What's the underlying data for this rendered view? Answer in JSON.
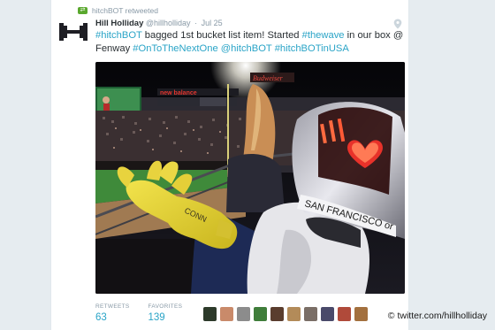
{
  "retweet_line": "hitchBOT retweeted",
  "tweet": {
    "author_name": "Hill Holliday",
    "handle": "@hillholliday",
    "separator": "·",
    "date": "Jul 25",
    "text_segments": [
      {
        "type": "tag",
        "text": "#hitchBOT"
      },
      {
        "type": "text",
        "text": " bagged 1st bucket list item! Started "
      },
      {
        "type": "tag",
        "text": "#thewave"
      },
      {
        "type": "text",
        "text": " in our box @ Fenway "
      },
      {
        "type": "tag",
        "text": "#OnToTheNextOne"
      },
      {
        "type": "text",
        "text": " "
      },
      {
        "type": "mention",
        "text": "@hitchBOT"
      },
      {
        "type": "text",
        "text": " "
      },
      {
        "type": "tag",
        "text": "#hitchBOTinUSA"
      }
    ],
    "photo": {
      "bot_text": "SAN FRANCISCO or",
      "glove_text": "CONN",
      "scoreboard_text": "Budweiser",
      "sign_text": "new balance"
    }
  },
  "stats": {
    "retweets_label": "RETWEETS",
    "retweets_value": "63",
    "favorites_label": "FAVORITES",
    "favorites_value": "139"
  },
  "favoriter_avatar_colors": [
    "#2d3a2a",
    "#c98a6a",
    "#8c8c8c",
    "#3f7d3a",
    "#5a3d2e",
    "#b38b59",
    "#7a6e66",
    "#4a4a6a",
    "#b04a3a",
    "#a3703e"
  ],
  "credit": "© twitter.com/hillholliday",
  "colors": {
    "link": "#2aa4c7",
    "retweet_green": "#5aa82e",
    "heart_red": "#e8322a"
  }
}
